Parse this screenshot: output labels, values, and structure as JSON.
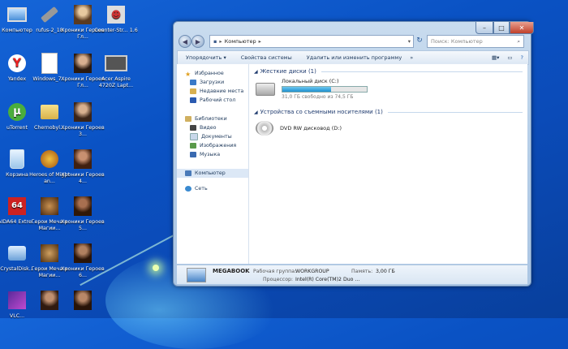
{
  "desktop": {
    "icons": [
      {
        "label": "Компьютер",
        "icon": "computer-icon"
      },
      {
        "label": "rufus-2_18",
        "icon": "usb-drive-icon"
      },
      {
        "label": "Хроники Героев Гл...",
        "icon": "game-character-icon"
      },
      {
        "label": "Counter-Str... 1.6",
        "icon": "cs-logo-icon"
      },
      {
        "label": "Yandex",
        "icon": "yandex-browser-icon"
      },
      {
        "label": "Windows_7...",
        "icon": "file-icon"
      },
      {
        "label": "Хроники Героев Гл...",
        "icon": "game-character-icon"
      },
      {
        "label": "Acer Aspire 4720Z Lapt...",
        "icon": "laptop-icon"
      },
      {
        "label": "uTorrent",
        "icon": "utorrent-icon"
      },
      {
        "label": "Chernobyl...",
        "icon": "folder-icon"
      },
      {
        "label": "Хроники Героев 3...",
        "icon": "game-character-icon"
      },
      {
        "label": "Корзина",
        "icon": "recycle-bin-icon"
      },
      {
        "label": "Heroes of Might an...",
        "icon": "heroes-icon"
      },
      {
        "label": "Хроники Героев 4...",
        "icon": "game-character-icon"
      },
      {
        "label": "AIDA64 Extre...",
        "icon": "aida64-icon"
      },
      {
        "label": "Герои Меча и Магии...",
        "icon": "heroes-icon"
      },
      {
        "label": "Хроники Героев 5...",
        "icon": "game-character-icon"
      },
      {
        "label": "CrystalDisk...",
        "icon": "crystaldisk-icon"
      },
      {
        "label": "Герои Меча и Магии...",
        "icon": "heroes-icon"
      },
      {
        "label": "Хроники Героев 6...",
        "icon": "game-character-icon"
      },
      {
        "label": "VLC...",
        "icon": "app-icon"
      },
      {
        "label": "",
        "icon": "game-character-icon"
      },
      {
        "label": "",
        "icon": "game-character-icon"
      }
    ]
  },
  "window": {
    "address": {
      "segments": [
        "Компьютер"
      ]
    },
    "search_placeholder": "Поиск: Компьютер",
    "toolbar": [
      "Упорядочить ▾",
      "Свойства системы",
      "Удалить или изменить программу",
      "»"
    ],
    "nav": {
      "favorites_title": "Избранное",
      "favorites": [
        "Загрузки",
        "Недавние места",
        "Рабочий стол"
      ],
      "libraries_title": "Библиотеки",
      "libraries": [
        "Видео",
        "Документы",
        "Изображения",
        "Музыка"
      ],
      "computer": "Компьютер",
      "network": "Сеть"
    },
    "sections": {
      "hdd_header": "Жесткие диски (1)",
      "drive_name": "Локальный диск (C:)",
      "drive_free": "31,0 ГБ свободно из 74,5 ГБ",
      "drive_used_fraction": 0.58,
      "removable_header": "Устройства со съемными носителями (1)",
      "dvd_name": "DVD RW дисковод (D:)"
    },
    "status": {
      "computer_name": "MEGABOOK",
      "workgroup_label": "Рабочая группа:",
      "workgroup": "WORKGROUP",
      "memory_label": "Память:",
      "memory": "3,00 ГБ",
      "cpu_label": "Процессор:",
      "cpu": "Intel(R) Core(TM)2 Duo ..."
    }
  }
}
